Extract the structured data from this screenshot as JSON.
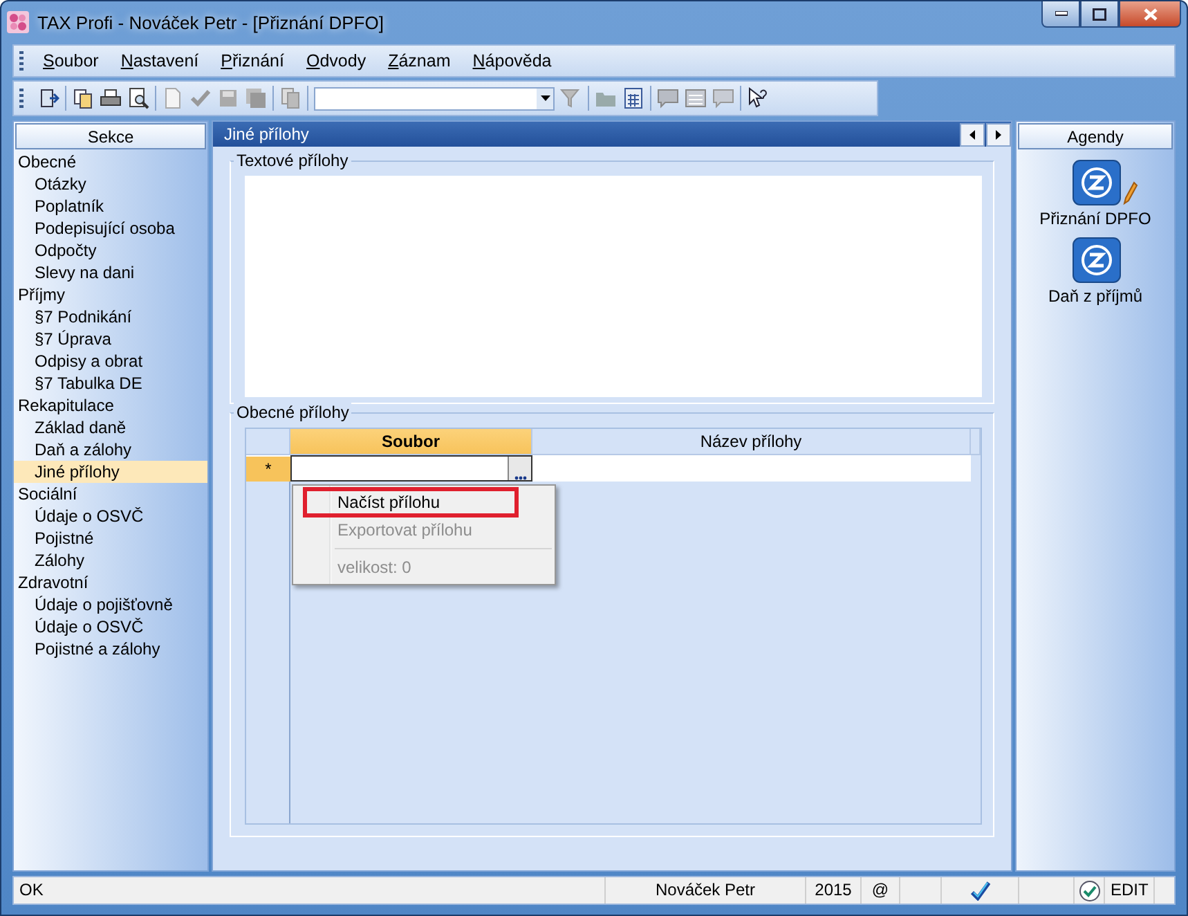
{
  "window": {
    "title": "TAX Profi - Nováček Petr - [Přiznání DPFO]"
  },
  "menu": [
    {
      "label": "Soubor"
    },
    {
      "label": "Nastavení"
    },
    {
      "label": "Přiznání"
    },
    {
      "label": "Odvody"
    },
    {
      "label": "Záznam"
    },
    {
      "label": "Nápověda"
    }
  ],
  "sidebar": {
    "title": "Sekce",
    "groups": [
      {
        "label": "Obecné",
        "selected": false,
        "children": [
          {
            "label": "Otázky",
            "selected": false
          },
          {
            "label": "Poplatník",
            "selected": false
          },
          {
            "label": "Podepisující osoba",
            "selected": false
          },
          {
            "label": "Odpočty",
            "selected": false
          },
          {
            "label": "Slevy na dani",
            "selected": false
          }
        ]
      },
      {
        "label": "Příjmy",
        "selected": false,
        "children": [
          {
            "label": "§7 Podnikání",
            "selected": false
          },
          {
            "label": "§7 Úprava",
            "selected": false
          },
          {
            "label": "Odpisy a obrat",
            "selected": false
          },
          {
            "label": "§7 Tabulka DE",
            "selected": false
          }
        ]
      },
      {
        "label": "Rekapitulace",
        "selected": false,
        "children": [
          {
            "label": "Základ daně",
            "selected": false
          },
          {
            "label": "Daň a zálohy",
            "selected": false
          },
          {
            "label": "Jiné přílohy",
            "selected": true
          }
        ]
      },
      {
        "label": "Sociální",
        "selected": false,
        "children": [
          {
            "label": "Údaje o OSVČ",
            "selected": false
          },
          {
            "label": "Pojistné",
            "selected": false
          },
          {
            "label": "Zálohy",
            "selected": false
          }
        ]
      },
      {
        "label": "Zdravotní",
        "selected": false,
        "children": [
          {
            "label": "Údaje o pojišťovně",
            "selected": false
          },
          {
            "label": "Údaje o OSVČ",
            "selected": false
          },
          {
            "label": "Pojistné a zálohy",
            "selected": false
          }
        ]
      }
    ]
  },
  "panel": {
    "title": "Jiné přílohy",
    "text_group": {
      "title": "Textové přílohy"
    },
    "general_group": {
      "title": "Obecné přílohy",
      "table": {
        "columns": [
          {
            "label": "Soubor",
            "selected": true
          },
          {
            "label": "Název přílohy",
            "selected": false
          }
        ],
        "new_row_marker": "*"
      },
      "context_menu": [
        {
          "label": "Načíst přílohu",
          "disabled": false,
          "highlighted": true
        },
        {
          "label": "Exportovat přílohu",
          "disabled": true,
          "highlighted": false
        },
        {
          "label": "velikost: 0",
          "disabled": true,
          "highlighted": false
        }
      ]
    }
  },
  "agendas": {
    "title": "Agendy",
    "items": [
      {
        "label": "Přiznání DPFO",
        "editing": true
      },
      {
        "label": "Daň z příjmů",
        "editing": false
      }
    ]
  },
  "status_bar": {
    "message": "OK",
    "user": "Nováček Petr",
    "year": "2015",
    "at": "@",
    "mode": "EDIT"
  }
}
